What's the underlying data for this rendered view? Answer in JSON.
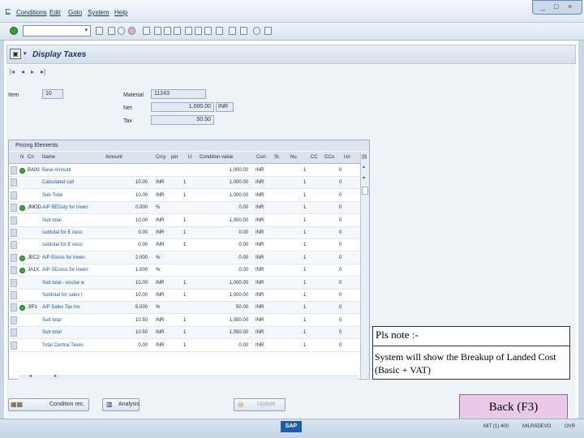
{
  "menu": {
    "items": [
      "Conditions",
      "Edit",
      "Goto",
      "System",
      "Help"
    ]
  },
  "window_controls": [
    "_",
    "□",
    "×"
  ],
  "toolbar": {
    "command_field": ""
  },
  "screen": {
    "title": "Display Taxes"
  },
  "header_fields": {
    "item_label": "Item",
    "item_value": "10",
    "material_label": "Material",
    "material_value": "11243",
    "net_label": "Net",
    "net_value": "1,000.00",
    "net_currency": "INR",
    "tax_label": "Tax",
    "tax_value": "50.50"
  },
  "pricing": {
    "title": "Pricing Elements",
    "columns": [
      "N",
      "Cn",
      "Name",
      "Amount",
      "Crcy",
      "per",
      "U",
      "Condition value",
      "Curr.",
      "St.",
      "Nu",
      "CC",
      "CCo",
      "Un"
    ],
    "rows": [
      {
        "led": true,
        "cntype": "BA00",
        "name": "Base Amount",
        "amount": "",
        "crcy": "",
        "per": "",
        "cond_value": "1,000.00",
        "curr": "INR",
        "nu": "1",
        "un": "0"
      },
      {
        "led": false,
        "cntype": "",
        "name": "Calculated call",
        "amount": "10.00",
        "crcy": "INR",
        "per": "1",
        "cond_value": "1,000.00",
        "curr": "INR",
        "nu": "1",
        "un": "0"
      },
      {
        "led": false,
        "cntype": "",
        "name": "Sub Total",
        "amount": "10.00",
        "crcy": "INR",
        "per": "1",
        "cond_value": "1,000.00",
        "curr": "INR",
        "nu": "1",
        "un": "0"
      },
      {
        "led": true,
        "cntype": "JMOD",
        "name": "A/P BEDuty for Inven",
        "amount": "0.000",
        "crcy": "%",
        "per": "",
        "cond_value": "0.00",
        "curr": "INR",
        "nu": "1",
        "un": "0"
      },
      {
        "led": false,
        "cntype": "",
        "name": "Sub total",
        "amount": "10.00",
        "crcy": "INR",
        "per": "1",
        "cond_value": "1,000.00",
        "curr": "INR",
        "nu": "1",
        "un": "0"
      },
      {
        "led": false,
        "cntype": "",
        "name": "subtotal for E cess",
        "amount": "0.00",
        "crcy": "INR",
        "per": "1",
        "cond_value": "0.00",
        "curr": "INR",
        "nu": "1",
        "un": "0"
      },
      {
        "led": false,
        "cntype": "",
        "name": "subtotal for E cess",
        "amount": "0.00",
        "crcy": "INR",
        "per": "1",
        "cond_value": "0.00",
        "curr": "INR",
        "nu": "1",
        "un": "0"
      },
      {
        "led": true,
        "cntype": "JEC2",
        "name": "A/P Ecess for Inven",
        "amount": "2.000",
        "crcy": "%",
        "per": "",
        "cond_value": "0.00",
        "curr": "INR",
        "nu": "1",
        "un": "0"
      },
      {
        "led": true,
        "cntype": "JA1X",
        "name": "A/P SEcess for Inven",
        "amount": "1.000",
        "crcy": "%",
        "per": "",
        "cond_value": "0.00",
        "curr": "INR",
        "nu": "1",
        "un": "0"
      },
      {
        "led": false,
        "cntype": "",
        "name": "Sub total - excise w",
        "amount": "10.00",
        "crcy": "INR",
        "per": "1",
        "cond_value": "1,000.00",
        "curr": "INR",
        "nu": "1",
        "un": "0"
      },
      {
        "led": false,
        "cntype": "",
        "name": "Subtotal for sales t",
        "amount": "10.00",
        "crcy": "INR",
        "per": "1",
        "cond_value": "1,000.00",
        "curr": "INR",
        "nu": "1",
        "un": "0"
      },
      {
        "led": true,
        "cntype": "JIP1",
        "name": "A/P Sales Tax Inv",
        "amount": "5.000",
        "crcy": "%",
        "per": "",
        "cond_value": "50.00",
        "curr": "INR",
        "nu": "1",
        "un": "0"
      },
      {
        "led": false,
        "cntype": "",
        "name": "Sub total",
        "amount": "10.50",
        "crcy": "INR",
        "per": "1",
        "cond_value": "1,050.00",
        "curr": "INR",
        "nu": "1",
        "un": "0"
      },
      {
        "led": false,
        "cntype": "",
        "name": "Sub total",
        "amount": "10.50",
        "crcy": "INR",
        "per": "1",
        "cond_value": "1,050.00",
        "curr": "INR",
        "nu": "1",
        "un": "0"
      },
      {
        "led": false,
        "cntype": "",
        "name": "Total Central Taxes",
        "amount": "0.00",
        "crcy": "INR",
        "per": "1",
        "cond_value": "0.00",
        "curr": "INR",
        "nu": "1",
        "un": "0"
      }
    ]
  },
  "buttons": {
    "condition_rec": "Condition rec.",
    "analysis": "Analysis",
    "update": "Update"
  },
  "note": {
    "title": "Pls note :-",
    "body": "System will show the Breakup of Landed Cost  (Basic + VAT)"
  },
  "back_button": "Back (F3)",
  "status": {
    "sap": "SAP",
    "system": "MIT (1) 400",
    "server": "MILRSDEVO",
    "mode": "OVR"
  }
}
